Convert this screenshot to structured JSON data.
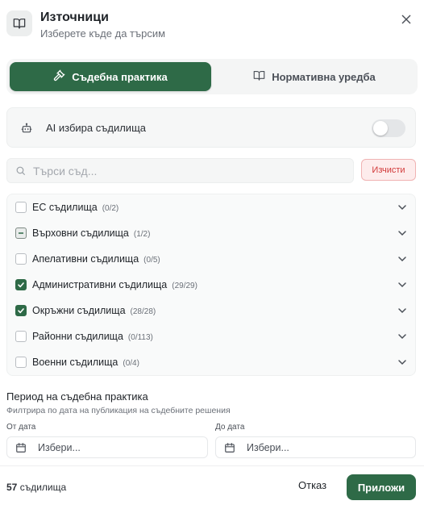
{
  "header": {
    "title": "Източници",
    "subtitle": "Изберете къде да търсим",
    "icon": "book-icon",
    "close_icon": "close-icon"
  },
  "tabs": [
    {
      "label": "Съдебна практика",
      "icon": "gavel-icon",
      "active": true
    },
    {
      "label": "Нормативна уредба",
      "icon": "book-icon",
      "active": false
    }
  ],
  "ai_toggle": {
    "label": "AI избира съдилища",
    "icon": "robot-icon",
    "enabled": false
  },
  "search": {
    "placeholder": "Търси съд...",
    "value": "",
    "clear_label": "Изчисти"
  },
  "courts": [
    {
      "name": "ЕС съдилища",
      "count": "(0/2)",
      "state": "unchecked"
    },
    {
      "name": "Върховни съдилища",
      "count": "(1/2)",
      "state": "partial"
    },
    {
      "name": "Апелативни съдилища",
      "count": "(0/5)",
      "state": "unchecked"
    },
    {
      "name": "Административни съдилища",
      "count": "(29/29)",
      "state": "checked"
    },
    {
      "name": "Окръжни съдилища",
      "count": "(28/28)",
      "state": "checked"
    },
    {
      "name": "Районни съдилища",
      "count": "(0/113)",
      "state": "unchecked"
    },
    {
      "name": "Военни съдилища",
      "count": "(0/4)",
      "state": "unchecked"
    }
  ],
  "period": {
    "title": "Период на съдебна практика",
    "description": "Филтрира по дата на публикация на съдебните решения",
    "from_label": "От дата",
    "to_label": "До дата",
    "from_placeholder": "Избери...",
    "to_placeholder": "Избери..."
  },
  "footer": {
    "count": "57",
    "count_suffix": "съдилища",
    "cancel_label": "Отказ",
    "apply_label": "Приложи"
  },
  "colors": {
    "accent": "#2e6a47",
    "danger": "#d23a3a"
  }
}
